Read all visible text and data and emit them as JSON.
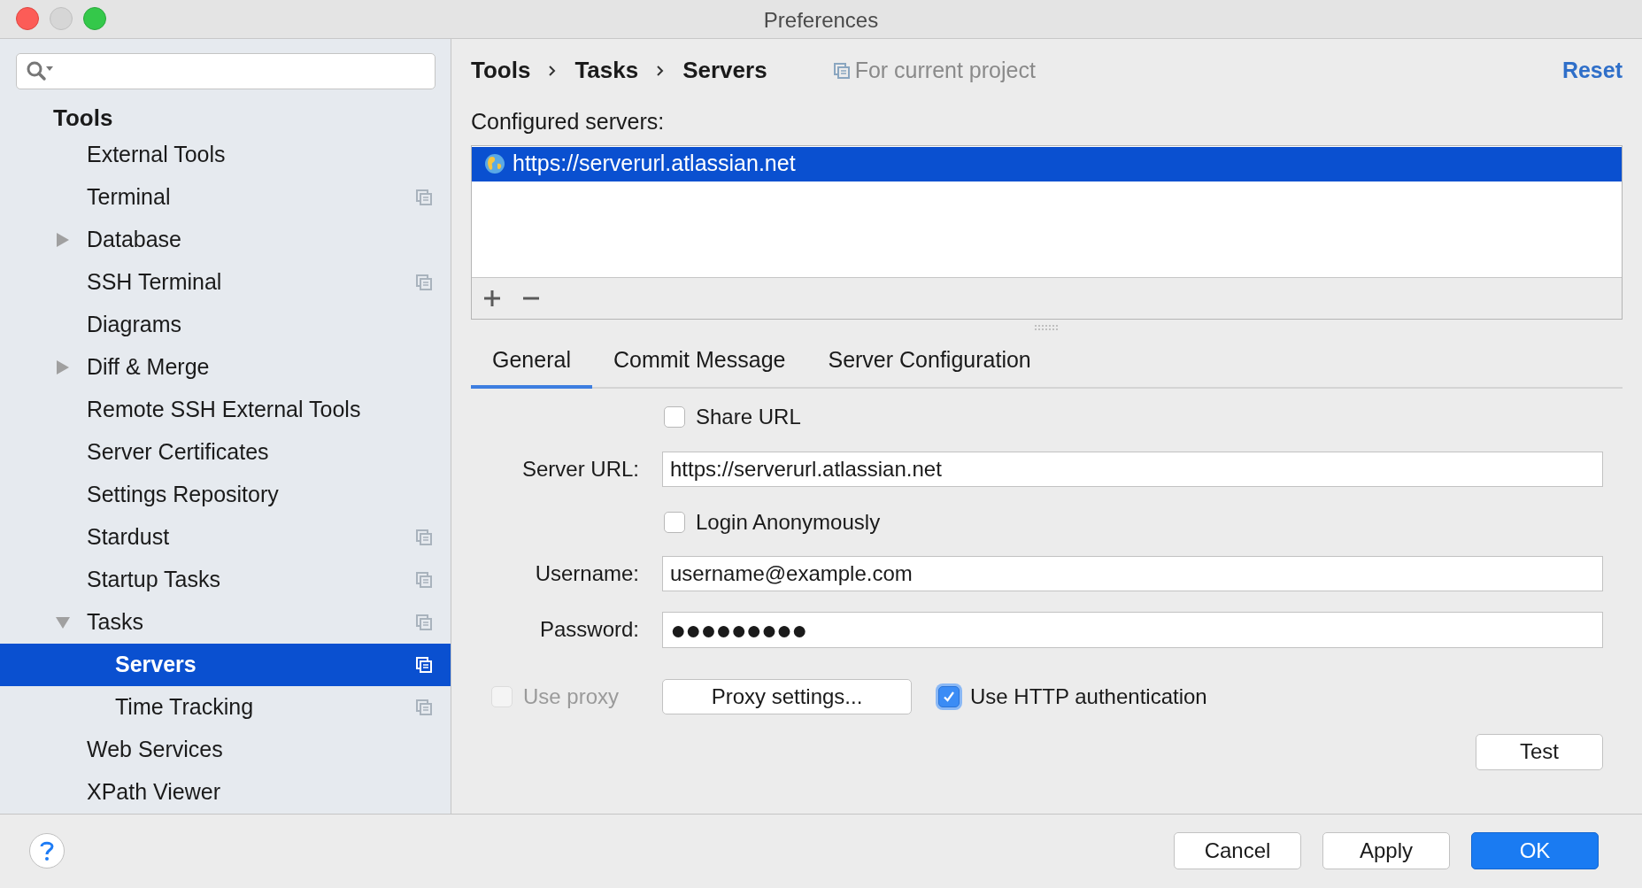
{
  "window": {
    "title": "Preferences"
  },
  "sidebar": {
    "section": "Tools",
    "items": [
      {
        "label": "External Tools",
        "selected": false,
        "project_scoped": false
      },
      {
        "label": "Terminal",
        "selected": false,
        "project_scoped": true
      },
      {
        "label": "Database",
        "selected": false,
        "project_scoped": false,
        "expanded": false
      },
      {
        "label": "SSH Terminal",
        "selected": false,
        "project_scoped": true
      },
      {
        "label": "Diagrams",
        "selected": false,
        "project_scoped": false
      },
      {
        "label": "Diff & Merge",
        "selected": false,
        "project_scoped": false,
        "expanded": false
      },
      {
        "label": "Remote SSH External Tools",
        "selected": false,
        "project_scoped": false
      },
      {
        "label": "Server Certificates",
        "selected": false,
        "project_scoped": false
      },
      {
        "label": "Settings Repository",
        "selected": false,
        "project_scoped": false
      },
      {
        "label": "Stardust",
        "selected": false,
        "project_scoped": true
      },
      {
        "label": "Startup Tasks",
        "selected": false,
        "project_scoped": true
      },
      {
        "label": "Tasks",
        "selected": false,
        "project_scoped": true,
        "expanded": true,
        "children": [
          {
            "label": "Servers",
            "selected": true,
            "project_scoped": true
          },
          {
            "label": "Time Tracking",
            "selected": false,
            "project_scoped": true
          }
        ]
      },
      {
        "label": "Web Services",
        "selected": false,
        "project_scoped": false
      },
      {
        "label": "XPath Viewer",
        "selected": false,
        "project_scoped": false
      }
    ]
  },
  "breadcrumb": [
    "Tools",
    "Tasks",
    "Servers"
  ],
  "scope": "For current project",
  "reset": "Reset",
  "configured_servers": {
    "label": "Configured servers:",
    "servers": [
      {
        "url": "https://serverurl.atlassian.net",
        "selected": true
      }
    ]
  },
  "tabs": [
    {
      "label": "General",
      "selected": true
    },
    {
      "label": "Commit Message",
      "selected": false
    },
    {
      "label": "Server Configuration",
      "selected": false
    }
  ],
  "form": {
    "share_url": {
      "label": "Share URL",
      "checked": false
    },
    "server_url": {
      "label": "Server URL:",
      "value": "https://serverurl.atlassian.net"
    },
    "login_anonymously": {
      "label": "Login Anonymously",
      "checked": false
    },
    "username": {
      "label": "Username:",
      "value": "username@example.com"
    },
    "password": {
      "label": "Password:",
      "value": "●●●●●●●●●"
    },
    "use_proxy": {
      "label": "Use proxy",
      "checked": false,
      "disabled": true
    },
    "proxy_settings": "Proxy settings...",
    "use_http_auth": {
      "label": "Use HTTP authentication",
      "checked": true
    },
    "test": "Test"
  },
  "footer_buttons": [
    {
      "label": "Cancel",
      "kind": "default"
    },
    {
      "label": "Apply",
      "kind": "default"
    },
    {
      "label": "OK",
      "kind": "primary"
    }
  ]
}
